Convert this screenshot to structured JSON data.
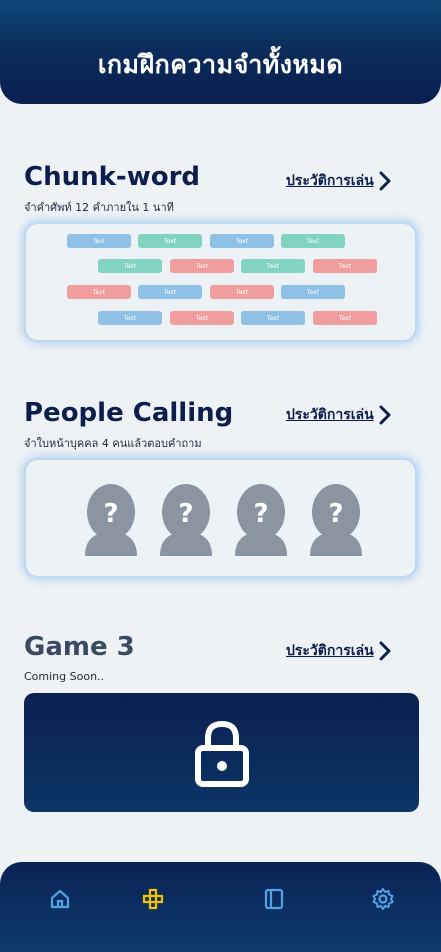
{
  "header": {
    "title": "เกมฝึกความจำทั้งหมด"
  },
  "games": [
    {
      "title": "Chunk-word",
      "subtitle": "จำคำศัพท์ 12 คำภายใน 1 นาที",
      "history_label": "ประวัติการเล่น",
      "chip_label": "Text",
      "chip_colors": {
        "blue": "#8fc0e6",
        "green": "#83d3c3",
        "red": "#ef9d9d"
      }
    },
    {
      "title": "People Calling",
      "subtitle": "จำใบหน้าบุคคล 4 คนแล้วตอบคำถาม",
      "history_label": "ประวัติการเล่น",
      "avatar_icon": "person-question-icon",
      "avatar_count": 4
    },
    {
      "title": "Game 3",
      "subtitle": "Coming Soon..",
      "history_label": "ประวัติการเล่น",
      "lock_icon": "lock-icon"
    }
  ],
  "tabbar": {
    "items": [
      {
        "icon": "home-icon",
        "active": false,
        "color": "#4fa3e6"
      },
      {
        "icon": "blocks-icon",
        "active": true,
        "color": "#f2c200"
      },
      {
        "icon": "book-icon",
        "active": false,
        "color": "#4fa3e6"
      },
      {
        "icon": "gear-icon",
        "active": false,
        "color": "#4fa3e6"
      }
    ]
  },
  "colors": {
    "primary": "#0c1e4d",
    "background": "#eef2f5",
    "card_border": "#bcd9f4"
  }
}
